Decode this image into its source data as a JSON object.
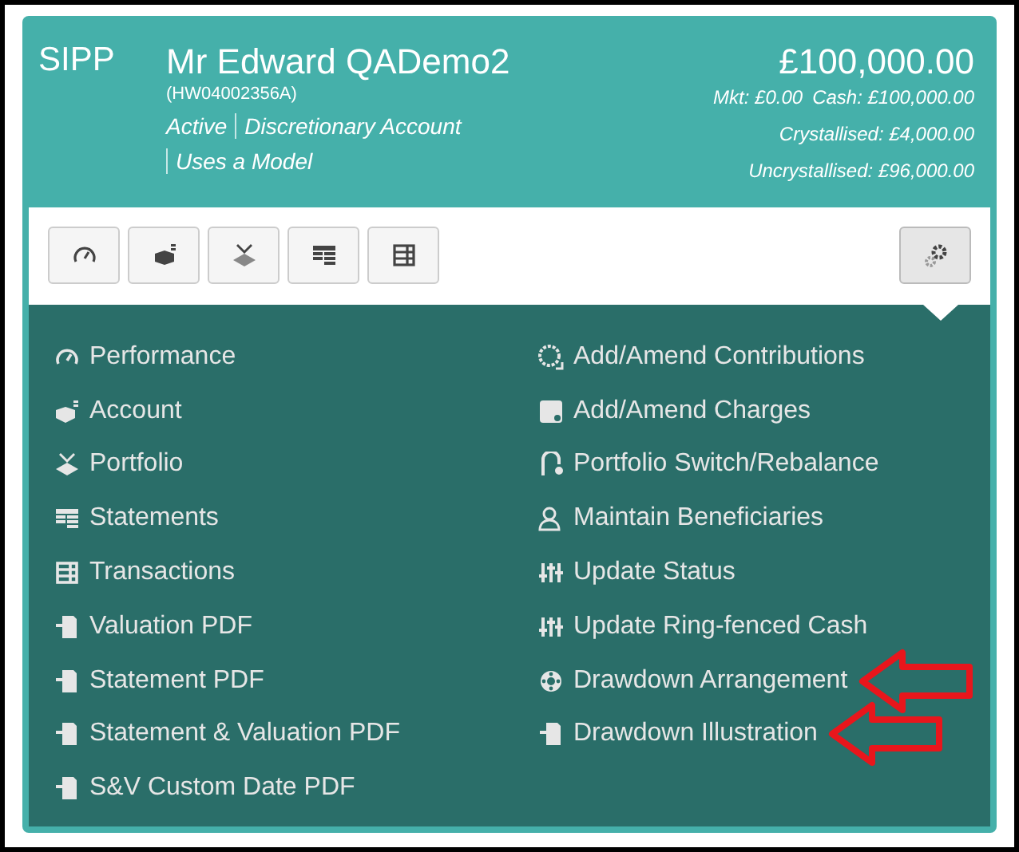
{
  "header": {
    "product": "SIPP",
    "client_name": "Mr Edward QADemo2",
    "client_ref": "(HW04002356A)",
    "tags": [
      "Active",
      "Discretionary Account",
      "Uses a Model"
    ],
    "total": "£100,000.00",
    "market": "Mkt: £0.00",
    "cash": "Cash: £100,000.00",
    "crystallised": "Crystallised: £4,000.00",
    "uncrystallised": "Uncrystallised: £96,000.00"
  },
  "toolbar": {
    "buttons": [
      {
        "kind": "gauge"
      },
      {
        "kind": "box"
      },
      {
        "kind": "portfolio"
      },
      {
        "kind": "table"
      },
      {
        "kind": "ledger"
      }
    ],
    "settings": {
      "kind": "gears",
      "selected": true
    }
  },
  "menu": {
    "columns": [
      [
        {
          "label": "Performance",
          "kind": "gauge",
          "highlighted": false
        },
        {
          "label": "Account",
          "kind": "box",
          "highlighted": false
        },
        {
          "label": "Portfolio",
          "kind": "portfolio",
          "highlighted": false
        },
        {
          "label": "Statements",
          "kind": "table",
          "highlighted": false
        },
        {
          "label": "Transactions",
          "kind": "ledger",
          "highlighted": false
        },
        {
          "label": "Valuation PDF",
          "kind": "document",
          "highlighted": false
        },
        {
          "label": "Statement PDF",
          "kind": "document",
          "highlighted": false
        },
        {
          "label": "Statement & Valuation PDF",
          "kind": "document",
          "highlighted": false
        },
        {
          "label": "S&V Custom Date PDF",
          "kind": "document",
          "highlighted": false
        }
      ],
      [
        {
          "label": "Add/Amend Contributions",
          "kind": "clock",
          "highlighted": false
        },
        {
          "label": "Add/Amend Charges",
          "kind": "square",
          "highlighted": false
        },
        {
          "label": "Portfolio Switch/Rebalance",
          "kind": "switch",
          "highlighted": false
        },
        {
          "label": "Maintain Beneficiaries",
          "kind": "person",
          "highlighted": false
        },
        {
          "label": "Update Status",
          "kind": "sliders",
          "highlighted": false
        },
        {
          "label": "Update Ring-fenced Cash",
          "kind": "sliders",
          "highlighted": false
        },
        {
          "label": "Drawdown Arrangement",
          "kind": "wheel",
          "highlighted": true
        },
        {
          "label": "Drawdown Illustration",
          "kind": "document",
          "highlighted": true
        }
      ]
    ]
  }
}
